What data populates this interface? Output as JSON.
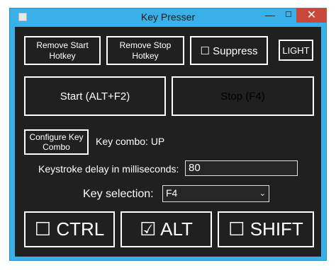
{
  "window": {
    "title": "Key Presser",
    "minimize": "—",
    "maximize": "☐",
    "close": "✕"
  },
  "buttons": {
    "remove_start": "Remove Start\nHotkey",
    "remove_stop": "Remove Stop\nHotkey",
    "suppress": "☐ Suppress",
    "light": "LIGHT",
    "start": "Start (ALT+F2)",
    "stop": "Stop (F4)",
    "configure": "Configure Key\nCombo"
  },
  "key_combo": "Key combo: UP",
  "delay": {
    "label": "Keystroke delay in milliseconds:",
    "value": "80"
  },
  "key_selection": {
    "label": "Key selection:",
    "value": "F4"
  },
  "modifiers": {
    "ctrl": "☐ CTRL",
    "alt": "☑ ALT",
    "shift": "☐ SHIFT"
  }
}
